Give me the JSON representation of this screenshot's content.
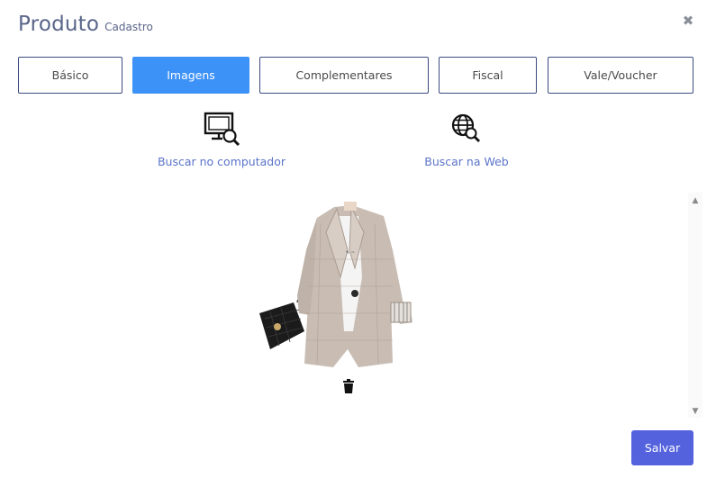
{
  "header": {
    "title": "Produto",
    "subtitle": "Cadastro",
    "close_symbol": "✖"
  },
  "tabs": [
    {
      "label": "Básico",
      "active": false
    },
    {
      "label": "Imagens",
      "active": true
    },
    {
      "label": "Complementares",
      "active": false
    },
    {
      "label": "Fiscal",
      "active": false
    },
    {
      "label": "Vale/Voucher",
      "active": false
    }
  ],
  "sources": {
    "computer": {
      "label": "Buscar no computador",
      "icon": "monitor-search-icon"
    },
    "web": {
      "label": "Buscar na Web",
      "icon": "globe-search-icon"
    }
  },
  "gallery": {
    "images": [
      {
        "description_icon": "product-image",
        "delete_icon": "trash-icon"
      }
    ],
    "scroll_up": "▲",
    "scroll_down": "▼"
  },
  "footer": {
    "save_label": "Salvar"
  },
  "colors": {
    "title": "#5a6589",
    "tab_border": "#3d4b80",
    "tab_active": "#3d92f7",
    "link": "#5b74c9",
    "save_button": "#5462dd"
  }
}
